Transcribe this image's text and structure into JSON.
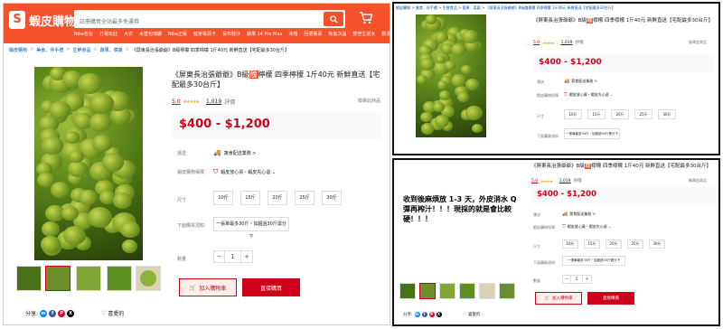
{
  "header": {
    "logo_text": "蝦皮購物",
    "logo_glyph": "S",
    "search_placeholder": "註冊購買全站最多免運券",
    "hot_words": [
      "Nike包包",
      "打電玩壯",
      "大衣",
      "水壺包瑞鑽",
      "Nike正版",
      "健身電源卡",
      "長布鞋仔",
      "蘋果 14 Pro Max",
      "冰箱",
      "回選餐桌",
      "吸髮次晶",
      "雙倍生前女",
      "動漫子食"
    ]
  },
  "breadcrumb": [
    "蝦皮購物",
    "美食、伴手禮",
    "生鮮食品",
    "蔬果、菜蔬",
    "《屏東長治張爺爺》B級檸檬 四季檸檬 1斤40元 新鮮直送【宅配最多30台斤】"
  ],
  "product": {
    "title_part1": "《屏東長治張爺爺》B級",
    "title_badge": "醜",
    "title_part2": "檸檬 四季檸檬 1斤40元 新鮮直送【宅配最多30台斤】",
    "rating": "5.0",
    "stars": "★★★★★",
    "reviews_count": "1,019",
    "reviews_label": "評價",
    "report_label": "檢舉此商品",
    "price": "$400 - $1,200",
    "shipping_label": "運送",
    "shipping_value": "蔬食配送業務 >",
    "guarantee_label": "蝦皮購物保障",
    "guarantee_value": "蝦皮放心買・蝦皮先心退 ⌄",
    "size_label": "尺寸",
    "sizes": [
      "10斤",
      "15斤",
      "20斤",
      "25斤",
      "30斤"
    ],
    "bulk_label": "下面購買須知",
    "bulk_value": "一張單最多30斤・如超過30斤需分下",
    "qty_label": "數量",
    "qty_minus": "−",
    "qty_value": "1",
    "qty_plus": "+",
    "add_cart_label": "加入購物車",
    "buy_now_label": "直接購買",
    "share_label": "分享:",
    "liked_label": "喜愛的",
    "prev_arrow": "‹"
  },
  "right_top": {
    "breadcrumb": "蝦皮購物 > 美食、伴手禮 > 生鮮食品 > 蔬果、菜蔬 > 《屏東長治張爺爺》B級醜檸檬 四季檸檬 1斤40元 新鮮直送【宅配最多30台斤】",
    "size_label": "尺寸",
    "bulk_label": "下面購買須知",
    "bulk_value": "一張單最多30斤・如超過30斤需分下"
  },
  "right_bottom": {
    "caption": "收到後麻煩放 1-3 天，外皮消水 Q 彈再榨汁！！！現採的就是會比較硬！！！"
  },
  "colors": {
    "brand": "#f5512a",
    "price": "#d0011b",
    "star": "#f5a623"
  }
}
